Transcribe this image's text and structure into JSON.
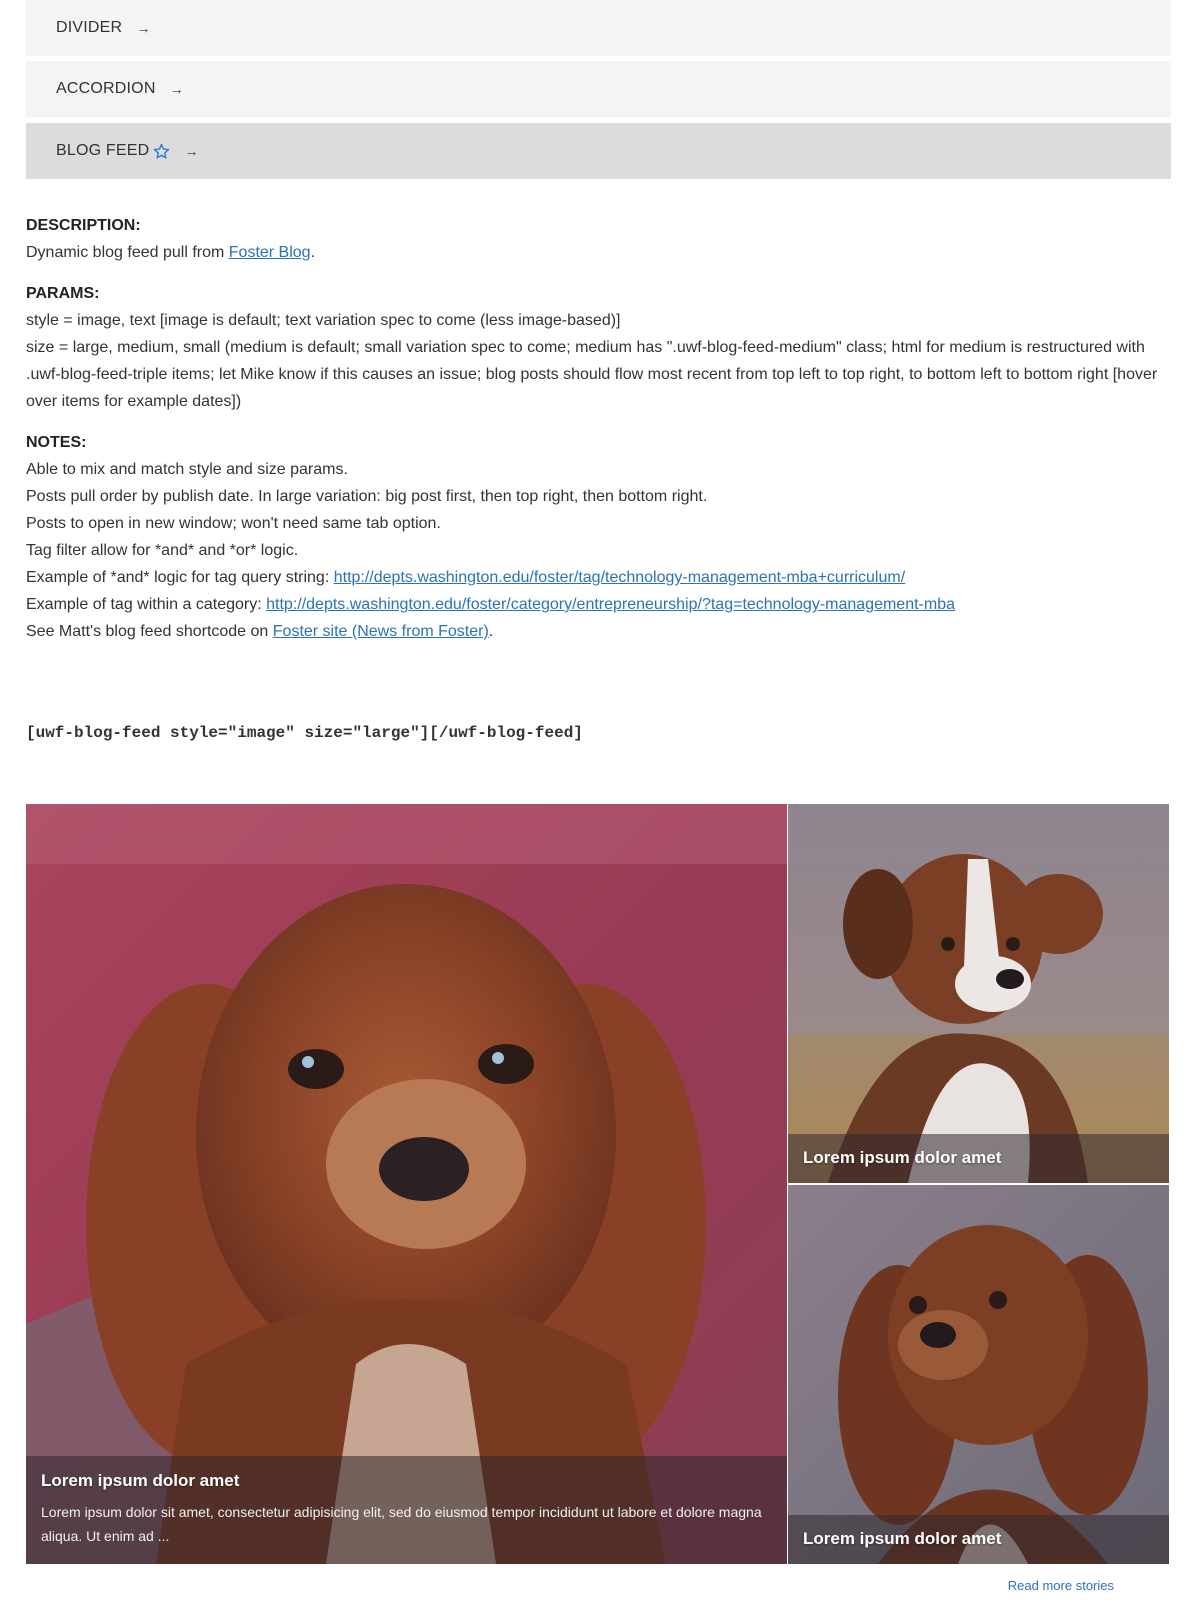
{
  "nav": {
    "items": [
      {
        "label": "DIVIDER",
        "arrow": "→"
      },
      {
        "label": "ACCORDION",
        "arrow": "→"
      },
      {
        "label": "BLOG FEED",
        "arrow": "→",
        "icon": "star-outline-icon",
        "active": true
      }
    ]
  },
  "description": {
    "title": "DESCRIPTION:",
    "text_prefix": "Dynamic blog feed pull from ",
    "link_text": "Foster Blog",
    "text_suffix": "."
  },
  "params": {
    "title": "PARAMS:",
    "line1": "style = image, text [image is default; text variation spec to come (less image-based)]",
    "line2": "size = large, medium, small (medium is default; small variation spec to come; medium has \".uwf-blog-feed-medium\" class; html for medium is restructured with .uwf-blog-feed-triple items; let Mike know if this causes an issue; blog posts should flow most recent from top left to top right, to bottom left to bottom right [hover over items for example dates])"
  },
  "notes": {
    "title": "NOTES:",
    "line1": "Able to mix and match style and size params.",
    "line2": "Posts pull order by publish date. In large variation: big post first, then top right, then bottom right.",
    "line3": "Posts to open in new window; won't need same tab option.",
    "line4": "Tag filter allow for *and* and *or* logic.",
    "line5_prefix": "Example of *and* logic for tag query string: ",
    "line5_link": "http://depts.washington.edu/foster/tag/technology-management-mba+curriculum/",
    "line6_prefix": "Example of tag within a category: ",
    "line6_link": "http://depts.washington.edu/foster/category/entrepreneurship/?tag=technology-management-mba",
    "line7_prefix": "See Matt's blog feed shortcode on ",
    "line7_link": "Foster site (News from Foster)",
    "line7_suffix": "."
  },
  "shortcode": "[uwf-blog-feed style=\"image\" size=\"large\"][/uwf-blog-feed]",
  "feed": {
    "big": {
      "title": "Lorem ipsum dolor amet",
      "excerpt": "Lorem ipsum dolor sit amet, consectetur adipisicing elit, sed do eiusmod tempor incididunt ut labore et dolore magna aliqua. Ut enim ad ...",
      "image": "dog-photo"
    },
    "top_right": {
      "title": "Lorem ipsum dolor amet",
      "image": "dog-photo"
    },
    "bottom_right": {
      "title": "Lorem ipsum dolor amet",
      "image": "dog-photo"
    },
    "read_more": "Read more stories"
  },
  "colors": {
    "link": "#2a73b5",
    "nav_bg": "#f4f4f4",
    "nav_active_bg": "#dcdcdc",
    "star": "#2a7fd4"
  }
}
